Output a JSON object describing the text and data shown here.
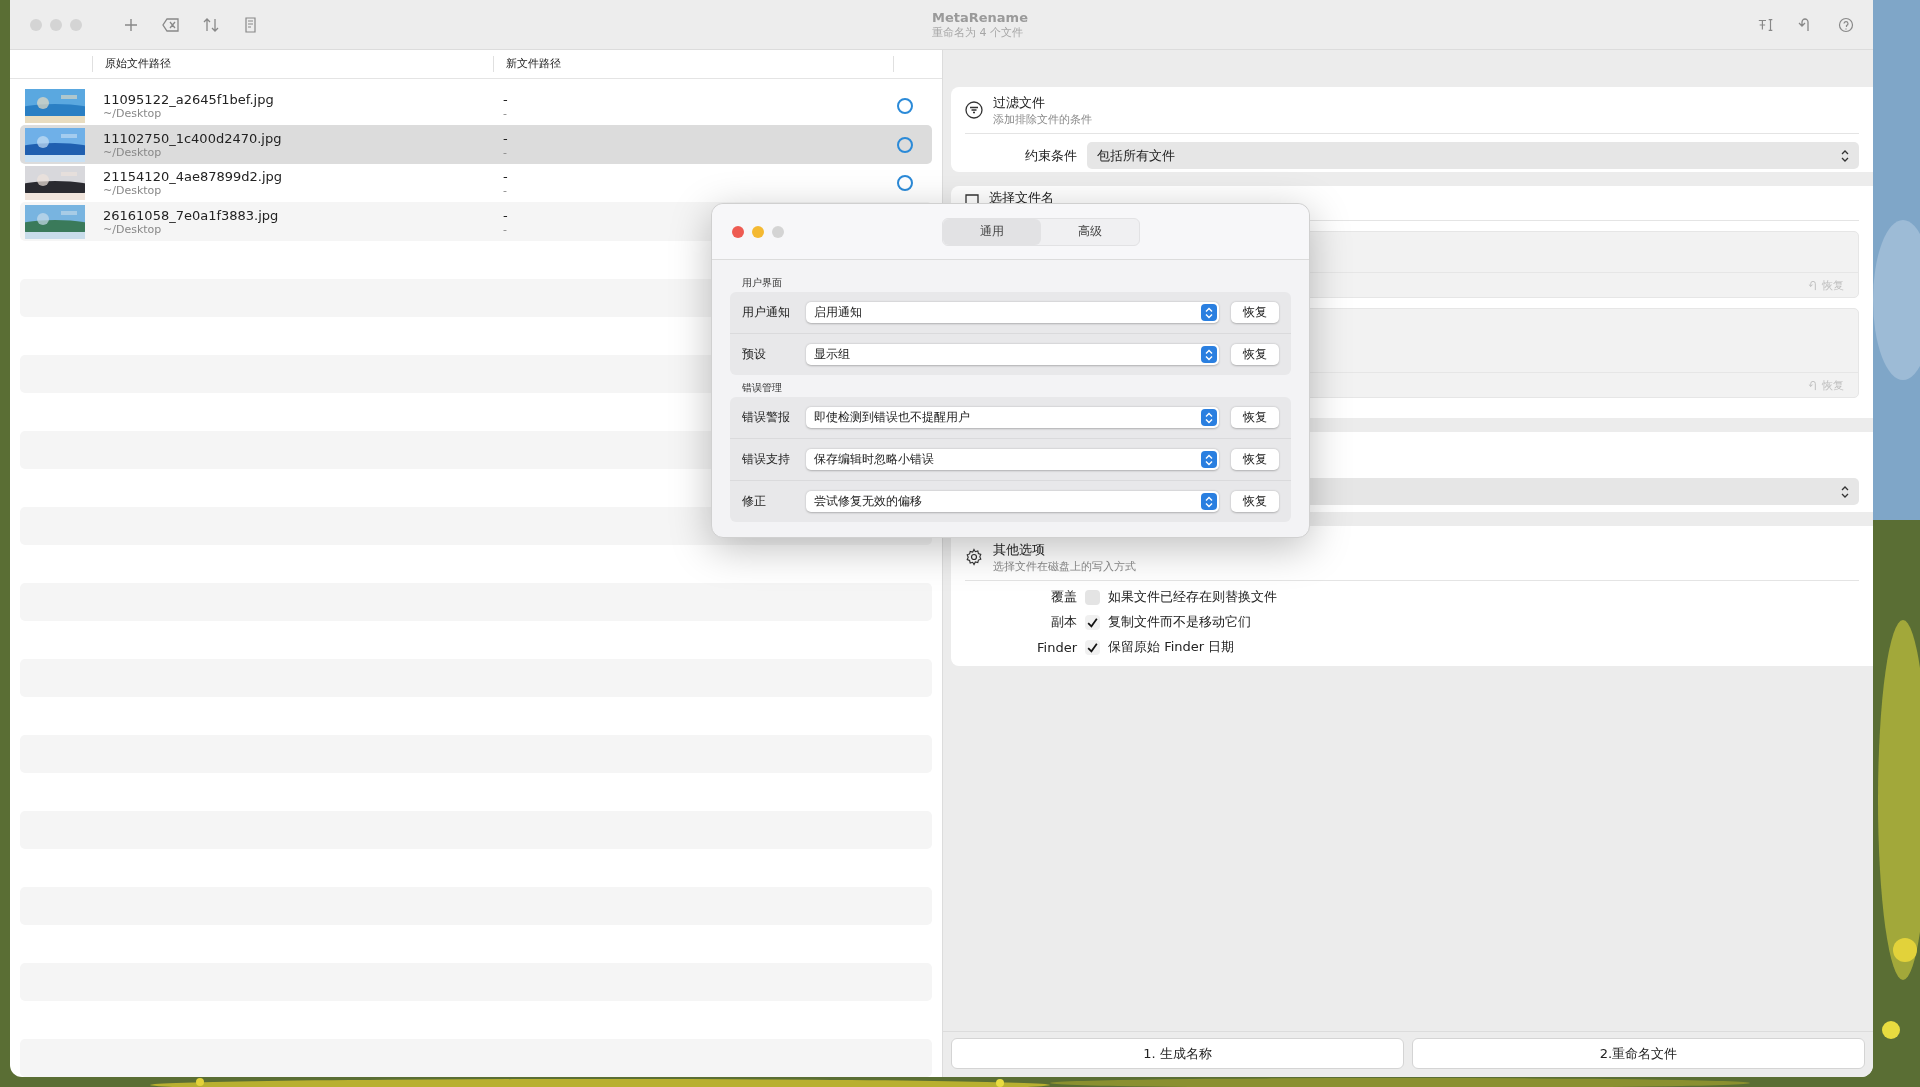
{
  "window": {
    "title": "MetaRename",
    "subtitle": "重命名为 4 个文件"
  },
  "table": {
    "columns": [
      "原始文件路径",
      "新文件路径"
    ],
    "rows": [
      {
        "name": "11095122_a2645f1bef.jpg",
        "folder": "~/Desktop",
        "new_name": "-",
        "new_folder": "-",
        "selected": false
      },
      {
        "name": "11102750_1c400d2470.jpg",
        "folder": "~/Desktop",
        "new_name": "-",
        "new_folder": "-",
        "selected": true
      },
      {
        "name": "21154120_4ae87899d2.jpg",
        "folder": "~/Desktop",
        "new_name": "-",
        "new_folder": "-",
        "selected": false
      },
      {
        "name": "26161058_7e0a1f3883.jpg",
        "folder": "~/Desktop",
        "new_name": "-",
        "new_folder": "-",
        "selected": false
      }
    ]
  },
  "filter": {
    "title": "过滤文件",
    "subtitle": "添加排除文件的条件",
    "label": "约束条件",
    "value": "包括所有文件"
  },
  "naming": {
    "title": "选择文件名",
    "restore": [
      "恢复",
      "恢复"
    ]
  },
  "other": {
    "title": "其他选项",
    "subtitle": "选择文件在磁盘上的写入方式",
    "options": [
      {
        "label": "覆盖",
        "text": "如果文件已经存在则替换文件",
        "checked": false
      },
      {
        "label": "副本",
        "text": "复制文件而不是移动它们",
        "checked": true
      },
      {
        "label": "Finder",
        "text": "保留原始 Finder 日期",
        "checked": true
      }
    ]
  },
  "buttons": [
    "1. 生成名称",
    "2.重命名文件"
  ],
  "dialog": {
    "tabs": [
      {
        "label": "通用",
        "selected": true
      },
      {
        "label": "高级",
        "selected": false
      }
    ],
    "sections": [
      {
        "title": "用户界面",
        "rows": [
          {
            "label": "用户通知",
            "value": "启用通知",
            "button": "恢复"
          },
          {
            "label": "预设",
            "value": "显示组",
            "button": "恢复"
          }
        ]
      },
      {
        "title": "错误管理",
        "rows": [
          {
            "label": "错误警报",
            "value": "即使检测到错误也不提醒用户",
            "button": "恢复"
          },
          {
            "label": "错误支持",
            "value": "保存编辑时忽略小错误",
            "button": "恢复"
          },
          {
            "label": "修正",
            "value": "尝试修复无效的偏移",
            "button": "恢复"
          }
        ]
      }
    ]
  }
}
